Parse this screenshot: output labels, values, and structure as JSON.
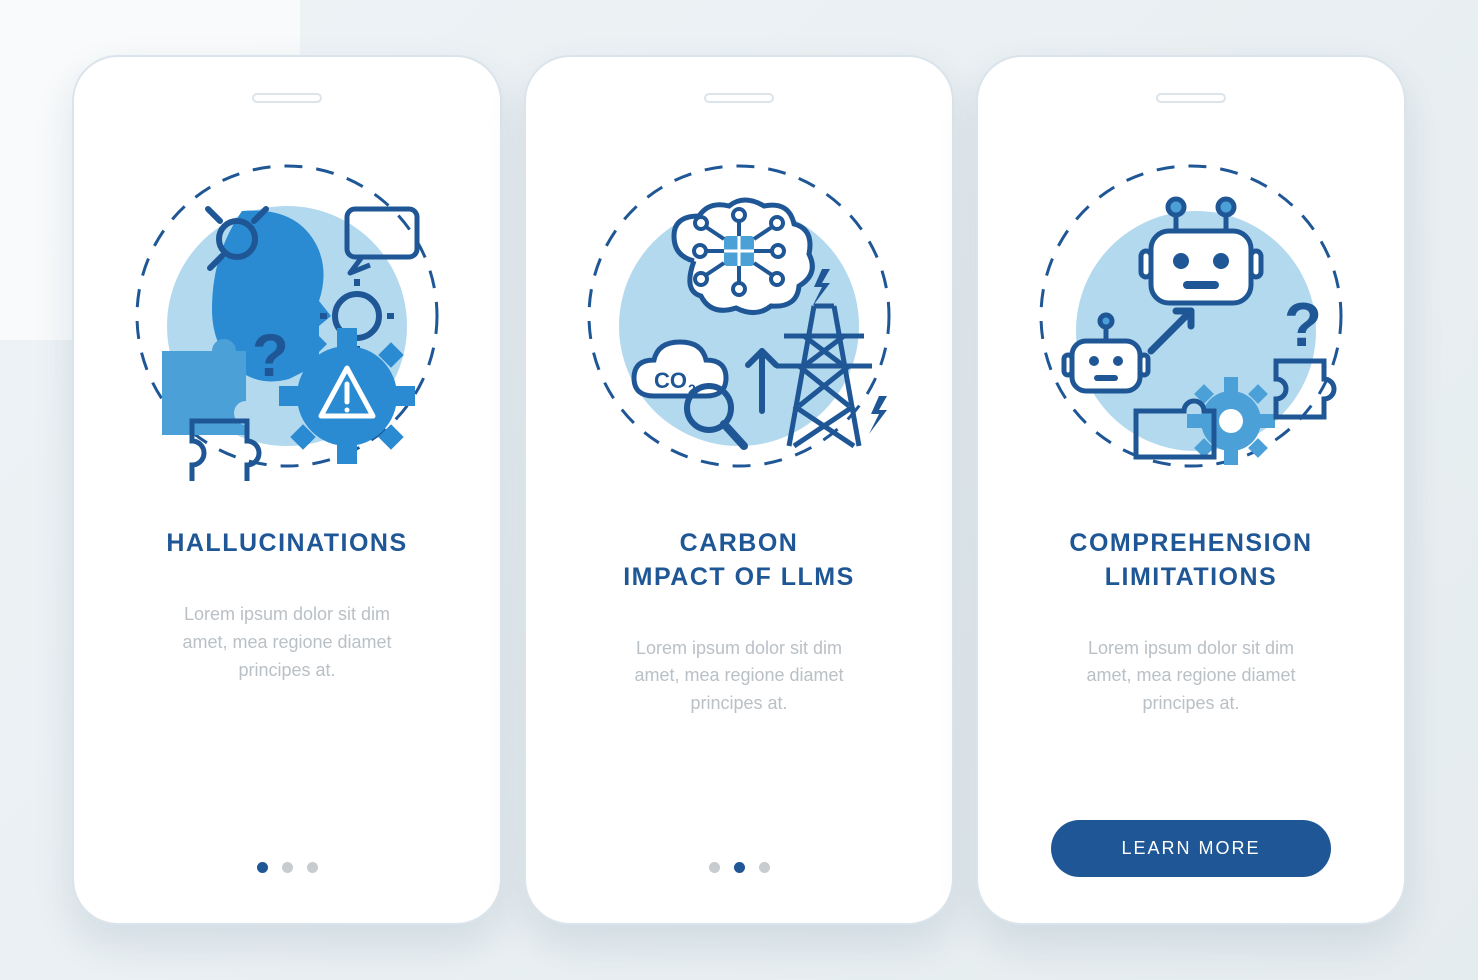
{
  "screens": [
    {
      "title": "HALLUCINATIONS",
      "description": "Lorem ipsum dolor sit dim\namet, mea regione diamet\nprincipes at.",
      "active_dot": 0,
      "has_button": false,
      "icon": "hallucinations-icon"
    },
    {
      "title": "CARBON\nIMPACT OF LLMS",
      "description": "Lorem ipsum dolor sit dim\namet, mea regione diamet\nprincipes at.",
      "active_dot": 1,
      "has_button": false,
      "icon": "carbon-impact-icon"
    },
    {
      "title": "COMPREHENSION\nLIMITATIONS",
      "description": "Lorem ipsum dolor sit dim\namet, mea regione diamet\nprincipes at.",
      "active_dot": 2,
      "has_button": true,
      "button_label": "LEARN MORE",
      "icon": "comprehension-icon"
    }
  ],
  "colors": {
    "primary": "#1f5796",
    "accent_light": "#b3d9ef",
    "accent_mid": "#4ca0d8",
    "text_muted": "#b9c0c6"
  }
}
